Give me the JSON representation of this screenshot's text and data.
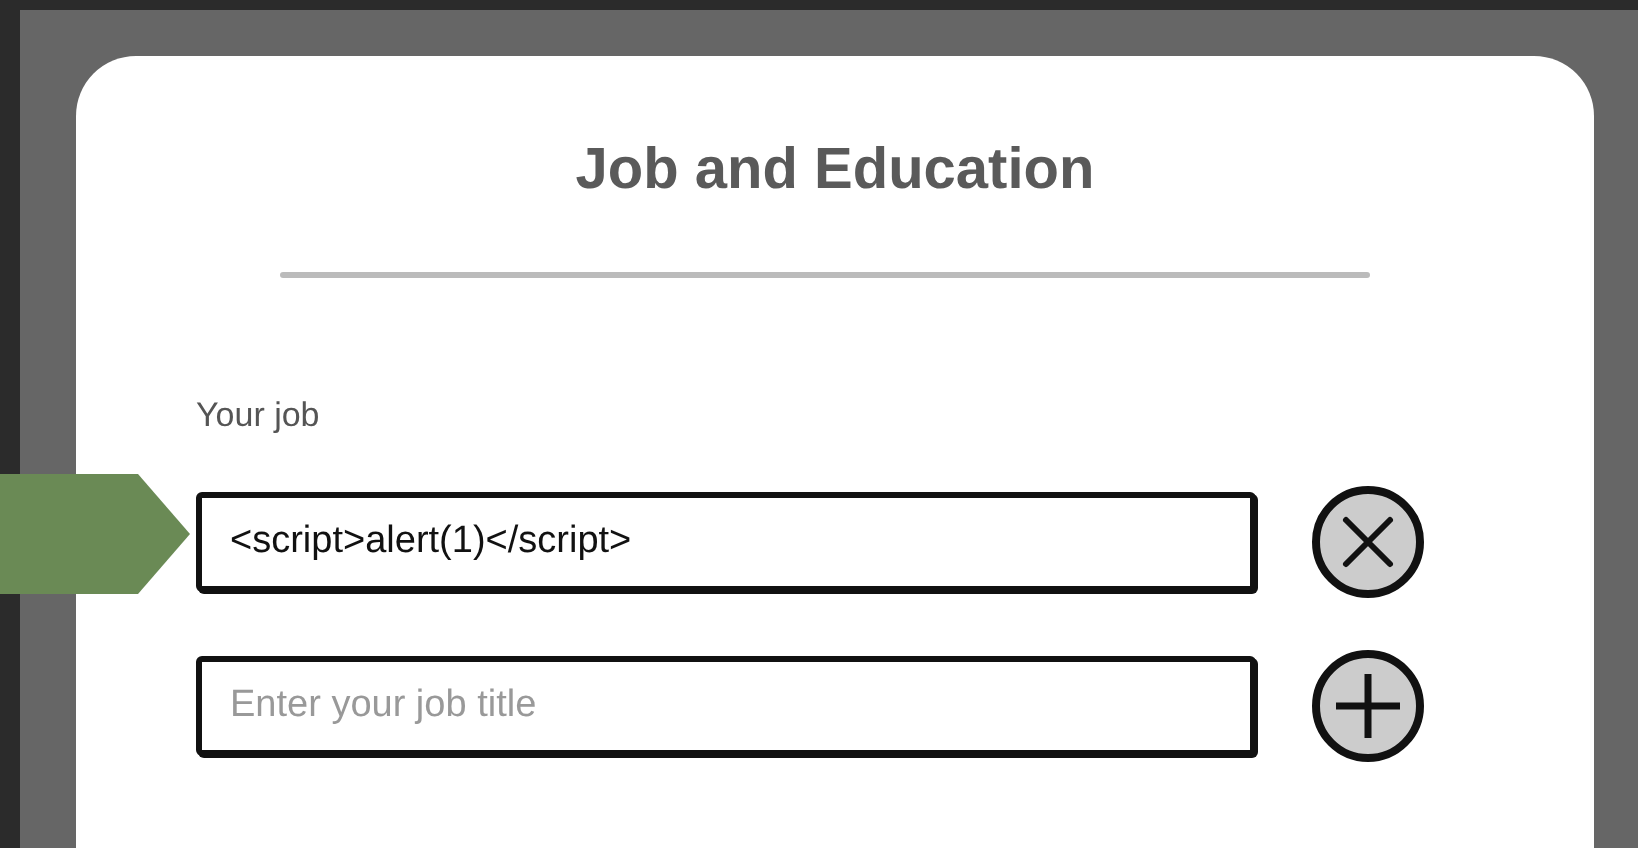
{
  "card": {
    "title": "Job and Education",
    "field_label": "Your job",
    "job_rows": [
      {
        "kind": "filled",
        "value": "<script>alert(1)</script>",
        "button": {
          "kind": "remove"
        }
      },
      {
        "kind": "empty",
        "placeholder": "Enter your job title",
        "button": {
          "kind": "add"
        }
      }
    ]
  }
}
